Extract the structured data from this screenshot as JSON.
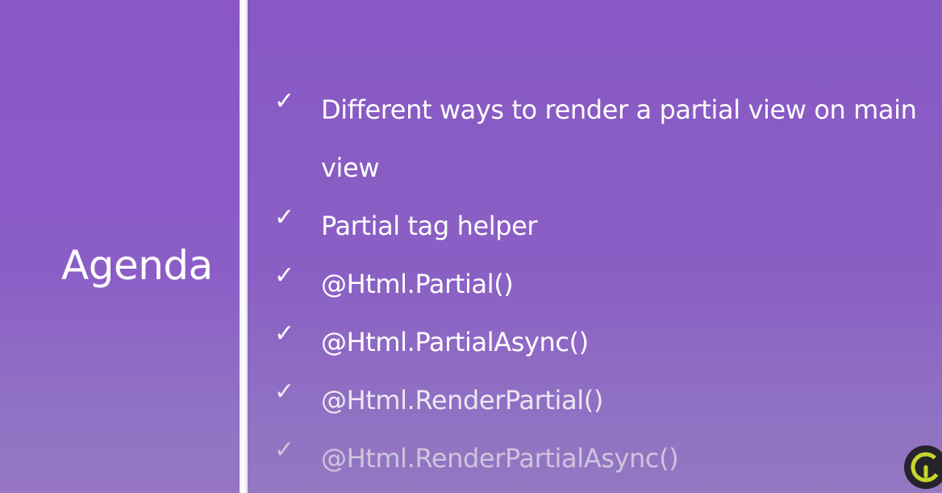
{
  "slide": {
    "title": "Agenda",
    "items": [
      {
        "check": "✓",
        "text": "Different ways to render a partial view on main view"
      },
      {
        "check": "✓",
        "text": "Partial tag helper"
      },
      {
        "check": "✓",
        "text": "@Html.Partial()"
      },
      {
        "check": "✓",
        "text": "@Html.PartialAsync()"
      },
      {
        "check": "✓",
        "text": "@Html.RenderPartial()"
      },
      {
        "check": "✓",
        "text": "@Html.RenderPartialAsync()"
      }
    ]
  },
  "colors": {
    "background": "#8a5cc4",
    "divider": "#ffffff",
    "text": "#ffffff",
    "logo_bg": "#24242a",
    "logo_accent": "#c7d62b"
  },
  "logo": {
    "icon": "channel-logo-icon"
  }
}
